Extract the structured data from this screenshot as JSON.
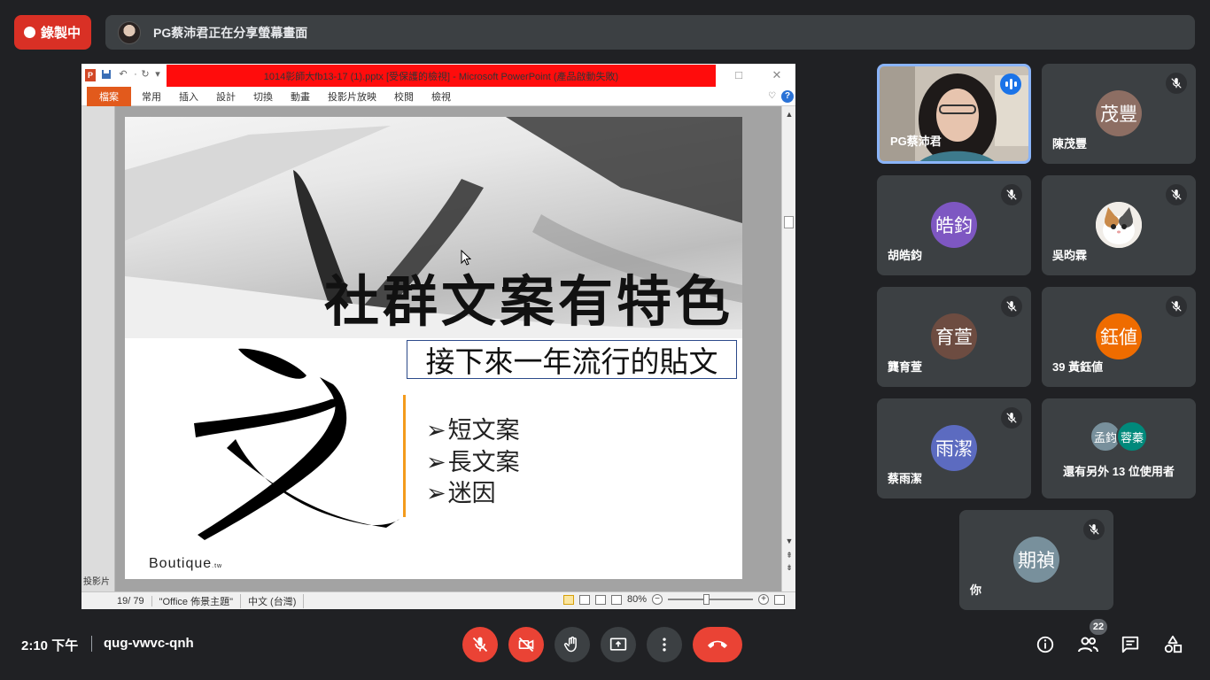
{
  "top_bar": {
    "recording_label": "錄製中",
    "share_banner_text": "PG蔡沛君正在分享螢幕畫面"
  },
  "ppt": {
    "window_title": "1014彰師大fb13-17 (1).pptx [受保護的檢視] - Microsoft PowerPoint (產品啟動失敗)",
    "app_icon": "P",
    "file_tab": "檔案",
    "tabs": [
      "常用",
      "插入",
      "設計",
      "切換",
      "動畫",
      "投影片放映",
      "校閱",
      "檢視"
    ],
    "slide_pane_label": "投影片",
    "slide": {
      "title": "社群文案有特色",
      "subtitle": "接下來一年流行的貼文",
      "bullet_marker": "➢",
      "bullets": [
        "短文案",
        "長文案",
        "迷因"
      ],
      "logo_text": "Boutique",
      "logo_suffix": ".tw"
    },
    "status": {
      "slide_counter": "19/ 79",
      "theme": "\"Office 佈景主題\"",
      "language": "中文 (台灣)",
      "zoom": "80%"
    }
  },
  "participants": [
    {
      "name": "PG蔡沛君",
      "speaking": true
    },
    {
      "name": "陳茂豐",
      "initials": "茂豐",
      "color": "#8d6e63"
    },
    {
      "name": "胡皓鈞",
      "initials": "皓鈞",
      "color": "#7e57c2"
    },
    {
      "name": "吳昀霖"
    },
    {
      "name": "龔育萱",
      "initials": "育萱",
      "color": "#6d4c41"
    },
    {
      "name": "39 黃鈺値",
      "initials": "鈺値",
      "color": "#ef6c00"
    },
    {
      "name": "蔡雨潔",
      "initials": "雨潔",
      "color": "#5c6bc0"
    },
    {
      "name": "你",
      "initials": "期禎",
      "color": "#78909c"
    }
  ],
  "more_users": {
    "label": "還有另外 13 位使用者",
    "avatars": [
      {
        "initials": "孟鈞",
        "color": "#78909c"
      },
      {
        "initials": "蓉蓁",
        "color": "#00897b"
      }
    ]
  },
  "bottom_bar": {
    "time": "2:10 下午",
    "meeting_code": "qug-vwvc-qnh",
    "people_count": "22"
  }
}
